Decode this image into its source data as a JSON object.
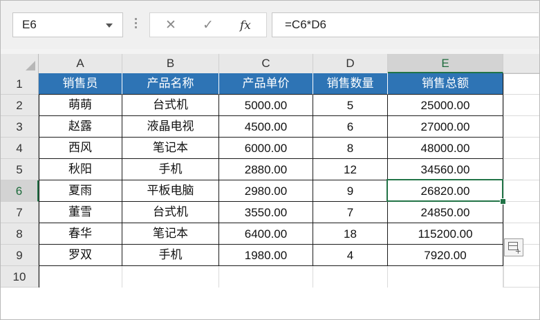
{
  "name_box": {
    "value": "E6"
  },
  "formula_bar": {
    "cancel_glyph": "✕",
    "enter_glyph": "✓",
    "fx_label": "fx",
    "formula": "=C6*D6"
  },
  "columns": [
    "A",
    "B",
    "C",
    "D",
    "E"
  ],
  "selected_column": "E",
  "rows": [
    "1",
    "2",
    "3",
    "4",
    "5",
    "6",
    "7",
    "8",
    "9",
    "10"
  ],
  "selected_row": "6",
  "table": {
    "header": [
      "销售员",
      "产品名称",
      "产品单价",
      "销售数量",
      "销售总额"
    ],
    "records": [
      [
        "萌萌",
        "台式机",
        "5000.00",
        "5",
        "25000.00"
      ],
      [
        "赵露",
        "液晶电视",
        "4500.00",
        "6",
        "27000.00"
      ],
      [
        "西风",
        "笔记本",
        "6000.00",
        "8",
        "48000.00"
      ],
      [
        "秋阳",
        "手机",
        "2880.00",
        "12",
        "34560.00"
      ],
      [
        "夏雨",
        "平板电脑",
        "2980.00",
        "9",
        "26820.00"
      ],
      [
        "董雪",
        "台式机",
        "3550.00",
        "7",
        "24850.00"
      ],
      [
        "春华",
        "笔记本",
        "6400.00",
        "18",
        "115200.00"
      ],
      [
        "罗双",
        "手机",
        "1980.00",
        "4",
        "7920.00"
      ]
    ]
  },
  "colors": {
    "header_fill": "#2e74b5",
    "selection": "#217346"
  },
  "quick_analysis_icon": "quick-analysis-icon"
}
